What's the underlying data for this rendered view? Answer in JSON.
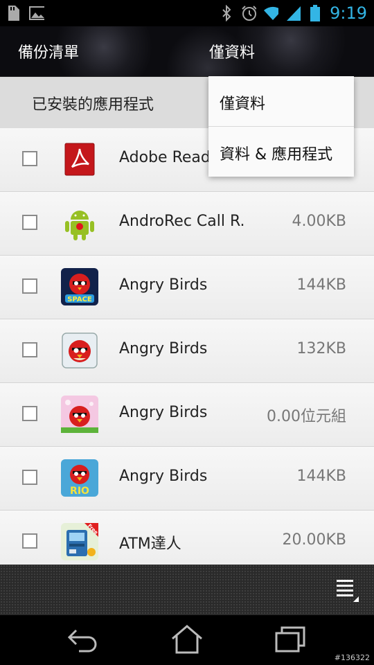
{
  "status_bar": {
    "time": "9:19",
    "left_icons": [
      "sd-card-icon",
      "image-icon"
    ],
    "right_icons": [
      "bluetooth-icon",
      "alarm-icon",
      "wifi-icon",
      "signal-icon",
      "battery-icon"
    ],
    "accent_color": "#33b5e5"
  },
  "action_bar": {
    "title": "備份清單",
    "filter_selected": "僅資料"
  },
  "section": {
    "label": "已安裝的應用程式"
  },
  "apps": [
    {
      "name": "Adobe Read",
      "size": "",
      "icon": "adobe-reader-icon"
    },
    {
      "name": "AndroRec Call R.",
      "size": "4.00KB",
      "icon": "android-robot-icon"
    },
    {
      "name": "Angry Birds",
      "size": "144KB",
      "icon": "angry-birds-space-icon"
    },
    {
      "name": "Angry Birds",
      "size": "132KB",
      "icon": "angry-birds-icon"
    },
    {
      "name": "Angry Birds",
      "size": "0.00位元組",
      "icon": "angry-birds-seasons-icon"
    },
    {
      "name": "Angry Birds",
      "size": "144KB",
      "icon": "angry-birds-rio-icon"
    },
    {
      "name": "ATM達人",
      "size": "20.00KB",
      "icon": "atm-app-icon"
    }
  ],
  "dropdown": {
    "options": [
      "僅資料",
      "資料 & 應用程式"
    ]
  },
  "watermark": "#136322"
}
